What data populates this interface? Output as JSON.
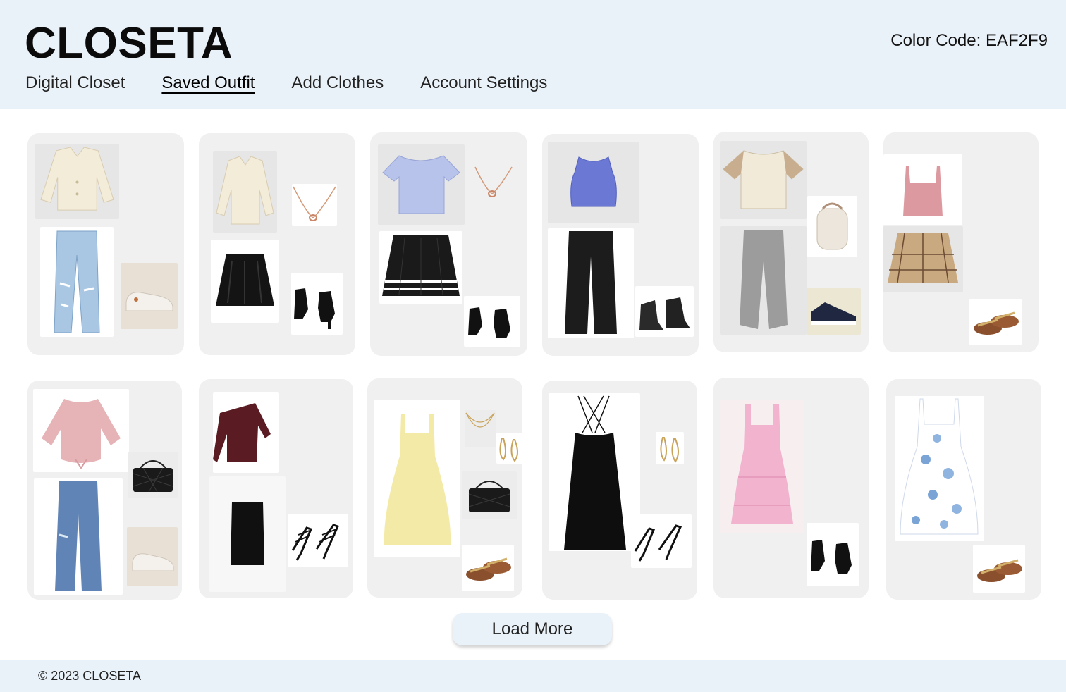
{
  "app": {
    "logo": "CLOSETA",
    "color_code": "Color Code: EAF2F9"
  },
  "nav": {
    "items": [
      {
        "label": "Digital Closet"
      },
      {
        "label": "Saved Outfit"
      },
      {
        "label": "Add Clothes"
      },
      {
        "label": "Account Settings"
      }
    ],
    "active_item": "Saved Outfit"
  },
  "outfits": [
    {
      "items": [
        "cream-cardigan",
        "ripped-light-jeans",
        "white-sneakers"
      ]
    },
    {
      "items": [
        "cream-cardigan",
        "rose-gold-necklace",
        "black-leather-skirt",
        "black-ankle-boots"
      ]
    },
    {
      "items": [
        "lavender-crop-top",
        "rose-gold-necklace",
        "black-pleated-skirt",
        "black-ankle-boots"
      ]
    },
    {
      "items": [
        "blue-knit-tank",
        "black-wide-jeans",
        "black-combat-boots"
      ]
    },
    {
      "items": [
        "beige-raglan-tee",
        "cream-mini-backpack",
        "grey-sweatpants",
        "navy-converse-sneakers"
      ]
    },
    {
      "items": [
        "pink-crop-tank",
        "plaid-mini-skort",
        "gold-strap-sandals"
      ]
    },
    {
      "items": [
        "pink-tie-blouse",
        "black-quilted-bag",
        "flare-jeans",
        "white-sneakers"
      ]
    },
    {
      "items": [
        "burgundy-one-shoulder-top",
        "black-pencil-skirt",
        "black-strappy-heels"
      ]
    },
    {
      "items": [
        "yellow-sundress",
        "layered-gold-necklace",
        "gold-teardrop-earrings",
        "black-quilted-bag",
        "gold-strap-sandals"
      ]
    },
    {
      "items": [
        "black-slip-dress",
        "gold-teardrop-earrings",
        "black-strappy-heels"
      ]
    },
    {
      "items": [
        "pink-tiered-dress",
        "black-ankle-boots"
      ]
    },
    {
      "items": [
        "blue-floral-dress",
        "gold-strap-sandals"
      ]
    }
  ],
  "load_more_label": "Load More",
  "footer": {
    "copyright": "© 2023 CLOSETA"
  },
  "colors": {
    "header_bg": "#EAF2F9",
    "card_bg": "#F0F0F0"
  }
}
